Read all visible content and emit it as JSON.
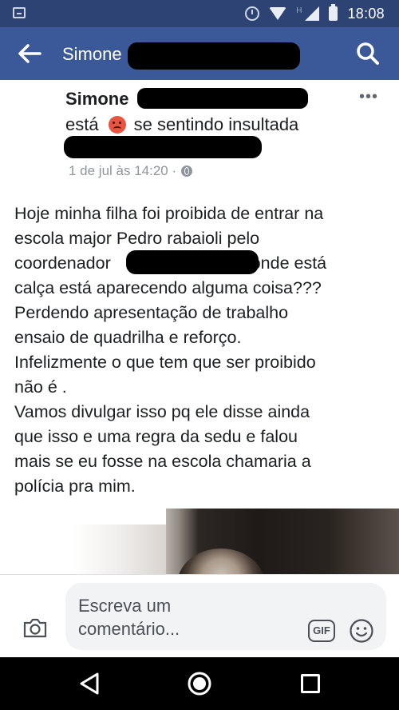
{
  "status_bar": {
    "time": "18:08",
    "network_label": "H"
  },
  "app_bar": {
    "title": "Simone"
  },
  "post": {
    "author": "Simone",
    "feeling_prefix": "está",
    "feeling_text": "se sentindo insultada",
    "timestamp": "1 de jul às 14:20 ·",
    "lines": [
      "Hoje minha filha foi proibida de entrar na",
      "escola major Pedro  rabaioli pelo",
      "coordenador",
      "aonde está",
      "calça está aparecendo alguma coisa???",
      "Perdendo apresentação de trabalho",
      "ensaio de quadrilha e reforço.",
      "Infelizmente o que tem que ser proibido",
      "não é .",
      "Vamos divulgar isso pq ele disse ainda",
      "que isso e uma regra da sedu e falou",
      "mais se eu fosse na escola chamaria a",
      "polícia pra mim."
    ]
  },
  "comment": {
    "placeholder": "Escreva um comentário...",
    "gif_label": "GIF"
  },
  "colors": {
    "app_bar": "#3b5998",
    "status_bar": "#2d4373",
    "meta_text": "#90949c"
  },
  "icons": [
    "back-arrow-icon",
    "search-icon",
    "more-icon",
    "globe-icon",
    "camera-icon",
    "gif-icon",
    "smiley-icon",
    "nav-back-icon",
    "nav-home-icon",
    "nav-recent-icon"
  ]
}
